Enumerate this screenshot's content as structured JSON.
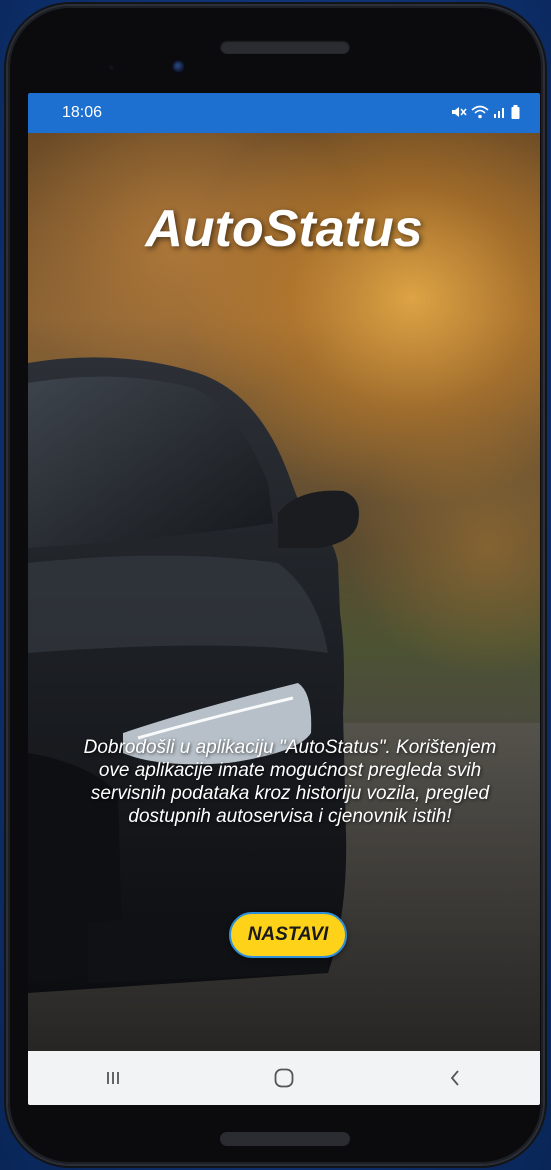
{
  "status_bar": {
    "time": "18:06",
    "icons": [
      "mute-icon",
      "wifi-icon",
      "signal-icon",
      "battery-icon"
    ]
  },
  "app": {
    "title": "AutoStatus",
    "intro_text": "Dobrodošli u aplikaciju \"AutoStatus\". Korištenjem ove aplikacije imate mogućnost pregleda svih servisnih podataka kroz historiju vozila, pregled dostupnih autoservisa i cjenovnik istih!",
    "continue_button": "NASTAVI"
  },
  "colors": {
    "status_bar": "#1d6fd0",
    "button_fill": "#ffd21a",
    "button_border": "#2f8fd8",
    "nav_bar": "#f2f3f5"
  },
  "nav_bar": {
    "buttons": [
      "recent-apps-icon",
      "home-icon",
      "back-icon"
    ]
  }
}
